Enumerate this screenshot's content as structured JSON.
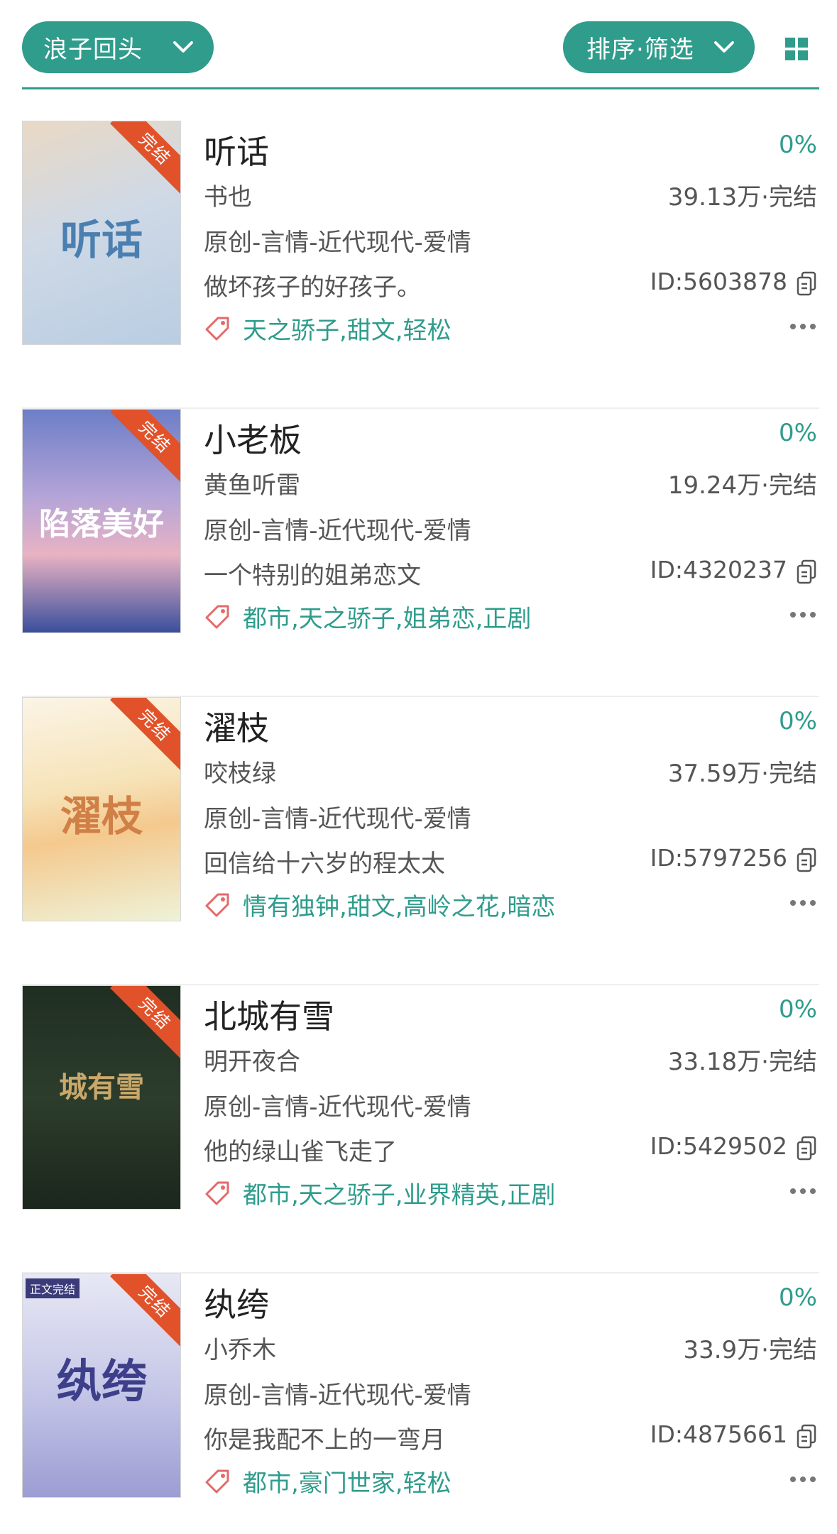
{
  "colors": {
    "accent": "#2f9c8c",
    "ribbon": "#e2522a",
    "text": "#333333"
  },
  "header": {
    "category_filter": "浪子回头",
    "sort_filter": "排序·筛选",
    "layout_toggle_icon": "grid-icon"
  },
  "books": [
    {
      "title": "听话",
      "author": "书也",
      "stats": "39.13万·完结",
      "category": "原创-言情-近代现代-爱情",
      "intro": "做坏孩子的好孩子。",
      "id": "ID:5603878",
      "tags": "天之骄子,甜文,轻松",
      "progress": "0%",
      "ribbon": "完结"
    },
    {
      "title": "小老板",
      "author": "黄鱼听雷",
      "stats": "19.24万·完结",
      "category": "原创-言情-近代现代-爱情",
      "intro": "一个特别的姐弟恋文",
      "id": "ID:4320237",
      "tags": "都市,天之骄子,姐弟恋,正剧",
      "progress": "0%",
      "ribbon": "完结"
    },
    {
      "title": "濯枝",
      "author": "咬枝绿",
      "stats": "37.59万·完结",
      "category": "原创-言情-近代现代-爱情",
      "intro": "回信给十六岁的程太太",
      "id": "ID:5797256",
      "tags": "情有独钟,甜文,高岭之花,暗恋",
      "progress": "0%",
      "ribbon": "完结"
    },
    {
      "title": "北城有雪",
      "author": "明开夜合",
      "stats": "33.18万·完结",
      "category": "原创-言情-近代现代-爱情",
      "intro": "他的绿山雀飞走了",
      "id": "ID:5429502",
      "tags": "都市,天之骄子,业界精英,正剧",
      "progress": "0%",
      "ribbon": "完结"
    },
    {
      "title": "纨绔",
      "author": "小乔木",
      "stats": "33.9万·完结",
      "category": "原创-言情-近代现代-爱情",
      "intro": "你是我配不上的一弯月",
      "id": "ID:4875661",
      "tags": "都市,豪门世家,轻松",
      "progress": "0%",
      "ribbon": "完结"
    }
  ],
  "covers": [
    {
      "text": "听话"
    },
    {
      "text": "陷落美好"
    },
    {
      "text": "濯枝"
    },
    {
      "text": "城有雪"
    },
    {
      "text": "纨绔",
      "corner": "正文完结"
    }
  ]
}
